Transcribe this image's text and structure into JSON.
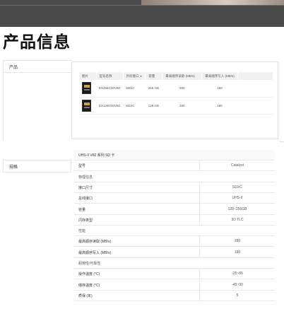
{
  "page": {
    "title": "产品信息"
  },
  "left_panels": {
    "products_label": "产品",
    "specs_label": "规格"
  },
  "products_table": {
    "headers": [
      "图片",
      "型号名称",
      "外形接口",
      "容量",
      "最高顺序读取 (MB/s)",
      "最高顺序写入 (MB/s)"
    ],
    "sort_indicator": "▼",
    "rows": [
      {
        "model": "EX256G00V60",
        "interface": "SDXC",
        "capacity": "256 GB",
        "read": "280",
        "write": "180"
      },
      {
        "model": "EX128G00V60",
        "interface": "SDXC",
        "capacity": "128 GB",
        "read": "280",
        "write": "180"
      }
    ]
  },
  "specs": {
    "header": "UHS-II V60 系列 SD 卡",
    "rows": [
      {
        "label": "型号",
        "value": "Catalyst",
        "group": false
      },
      {
        "label": "物理信息",
        "value": "",
        "group": true
      },
      {
        "label": "接口尺寸",
        "value": "SDXC",
        "group": false
      },
      {
        "label": "总线接口",
        "value": "UHS-II",
        "group": false
      },
      {
        "label": "容量",
        "value": "128~256GB",
        "group": false
      },
      {
        "label": "闪存类型",
        "value": "3D TLC",
        "group": false
      },
      {
        "label": "性能",
        "value": "",
        "group": true
      },
      {
        "label": "最高顺序读取 (MB/s)",
        "value": "280",
        "group": false
      },
      {
        "label": "最高顺序写入 (MB/s)",
        "value": "180",
        "group": false
      },
      {
        "label": "耐用性/可靠性",
        "value": "",
        "group": true
      },
      {
        "label": "操作温度 (°C)",
        "value": "-25~85",
        "group": false
      },
      {
        "label": "储存温度 (°C)",
        "value": "-45~90",
        "group": false
      },
      {
        "label": "质保 (年)",
        "value": "5",
        "group": false
      }
    ]
  }
}
